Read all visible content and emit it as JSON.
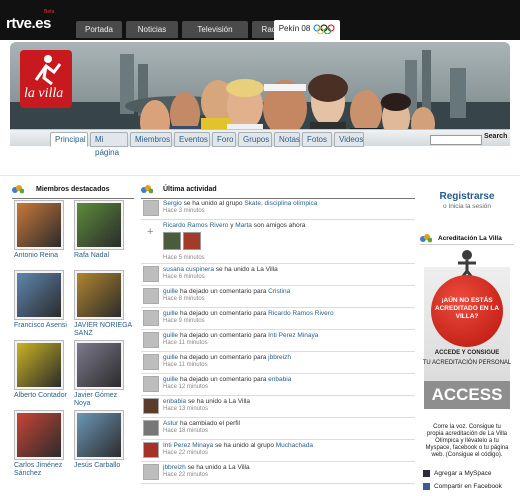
{
  "brand": {
    "logo": "rtve.es",
    "sub": "Beta"
  },
  "top_tabs": [
    {
      "label": "Portada",
      "active": false
    },
    {
      "label": "Noticias",
      "active": false
    },
    {
      "label": "Televisión",
      "active": false
    },
    {
      "label": "Radio",
      "active": false
    },
    {
      "label": "Pekín 08",
      "active": true
    }
  ],
  "banner": {
    "logo_text": "la villa"
  },
  "sub_tabs": [
    {
      "label": "Principal",
      "active": true
    },
    {
      "label": "Mi página",
      "active": false
    },
    {
      "label": "Miembros",
      "active": false
    },
    {
      "label": "Eventos",
      "active": false
    },
    {
      "label": "Foro",
      "active": false
    },
    {
      "label": "Grupos",
      "active": false
    },
    {
      "label": "Notas",
      "active": false
    },
    {
      "label": "Fotos",
      "active": false
    },
    {
      "label": "Videos",
      "active": false
    }
  ],
  "search": {
    "placeholder": "",
    "button": "Search"
  },
  "members": {
    "title": "Miembros destacados",
    "items": [
      {
        "name": "Antonio Reina",
        "color": "#c9783a"
      },
      {
        "name": "Rafa Nadal",
        "color": "#5d8b3b"
      },
      {
        "name": "Francisco Asensi",
        "color": "#5f86b0"
      },
      {
        "name": "JAVIER NORIEGA SANZ",
        "color": "#b0852e"
      },
      {
        "name": "Alberto Contador",
        "color": "#c9b322"
      },
      {
        "name": "Javier Gómez Noya",
        "color": "#7d7a8c"
      },
      {
        "name": "Carlos Jiménez Sánchez",
        "color": "#c84537"
      },
      {
        "name": "Jesús Carballo",
        "color": "#6b97b8"
      }
    ]
  },
  "activity": {
    "title": "Última actividad",
    "items": [
      {
        "parts": [
          [
            "Sergio",
            true
          ],
          [
            " se ha unido al grupo ",
            false
          ],
          [
            "Skate, disciplina olímpica",
            true
          ]
        ],
        "time": "Hace 3 minutos",
        "avatar": "#bdbdbd"
      },
      {
        "parts": [
          [
            "Ricardo Ramos Rivero",
            true
          ],
          [
            " y ",
            false
          ],
          [
            "Marta",
            true
          ],
          [
            " son amigos ahora",
            false
          ]
        ],
        "time": "Hace 5 minutos",
        "avatar": "#bdbdbd"
      },
      {
        "parts": [
          [
            "susana cuspinera",
            true
          ],
          [
            " se ha unido a La Villa",
            false
          ]
        ],
        "time": "Hace 6 minutos",
        "avatar": "#bdbdbd"
      },
      {
        "parts": [
          [
            "guille",
            true
          ],
          [
            " ha dejado un comentario para ",
            false
          ],
          [
            "Cristina",
            true
          ]
        ],
        "time": "Hace 8 minutos",
        "avatar": "#bdbdbd"
      },
      {
        "parts": [
          [
            "guille",
            true
          ],
          [
            " ha dejado un comentario para ",
            false
          ],
          [
            "Ricardo Ramos Rivero",
            true
          ]
        ],
        "time": "Hace 9 minutos",
        "avatar": "#bdbdbd"
      },
      {
        "parts": [
          [
            "guille",
            true
          ],
          [
            " ha dejado un comentario para ",
            false
          ],
          [
            "Inti Perez Minaya",
            true
          ]
        ],
        "time": "Hace 11 minutos",
        "avatar": "#bdbdbd"
      },
      {
        "parts": [
          [
            "guille",
            true
          ],
          [
            " ha dejado un comentario para ",
            false
          ],
          [
            "jbbreizh",
            true
          ]
        ],
        "time": "Hace 11 minutos",
        "avatar": "#bdbdbd"
      },
      {
        "parts": [
          [
            "guille",
            true
          ],
          [
            " ha dejado un comentario para ",
            false
          ],
          [
            "enbabia",
            true
          ]
        ],
        "time": "Hace 12 minutos",
        "avatar": "#bdbdbd"
      },
      {
        "parts": [
          [
            "enbabia",
            true
          ],
          [
            " se ha unido a La Villa",
            false
          ]
        ],
        "time": "Hace 13 minutos",
        "avatar": "#5a3c2a"
      },
      {
        "parts": [
          [
            "Astur",
            true
          ],
          [
            " ha cambiado el perfil",
            false
          ]
        ],
        "time": "Hace 18 minutos",
        "avatar": "#777777"
      },
      {
        "parts": [
          [
            "Inti Perez Minaya",
            true
          ],
          [
            " se ha unido al grupo ",
            false
          ],
          [
            "Muchachada",
            true
          ]
        ],
        "time": "Hace 22 minutos",
        "avatar": "#a4322a"
      },
      {
        "parts": [
          [
            "jbbreizh",
            true
          ],
          [
            " se ha unido a La Villa",
            false
          ]
        ],
        "time": "Hace 22 minutos",
        "avatar": "#bdbdbd"
      }
    ]
  },
  "right": {
    "register": "Registrarse",
    "login": "o Inicia la sesión",
    "promo_title": "Acreditación La Villa",
    "promo_circle": "¡AÚN NO ESTÁS ACREDITADO EN LA VILLA?",
    "promo_line1": "ACCEDE Y CONSIGUE",
    "promo_line2": "TU ACREDITACIÓN PERSONAL",
    "promo_access": "ACCESS",
    "promo_desc": "Corre la voz. Consigue tu propia acreditación de La Villa Olímpica y llévatelo a tu Myspace, facebook o tu página web. (Consigue el código).",
    "share": [
      {
        "label": "Agregar a MySpace",
        "icon": "myspace-icon"
      },
      {
        "label": "Compartir en Facebook",
        "icon": "facebook-icon"
      }
    ]
  },
  "colors": {
    "link": "#2a5f8a",
    "brand_red": "#c8191e",
    "topbar": "#111111"
  }
}
